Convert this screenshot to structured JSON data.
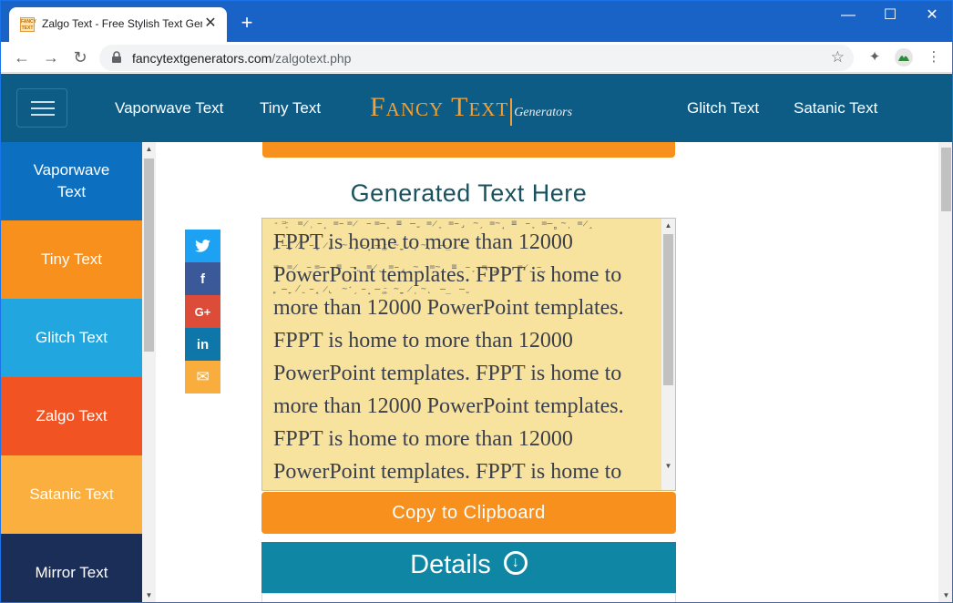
{
  "browser": {
    "tab_title": "Zalgo Text - Free Stylish Text Generator",
    "favicon_text": "FANCY TEXT",
    "url_host": "fancytextgenerators.com",
    "url_path": "/zalgotext.php",
    "new_tab": "+",
    "tab_close": "✕",
    "back": "←",
    "forward": "→",
    "reload": "↻",
    "minimize": "—",
    "maximize": "☐",
    "close": "✕",
    "star": "☆",
    "extensions": "✦",
    "menu": "⋮"
  },
  "header": {
    "nav_left": [
      "Vaporwave Text",
      "Tiny Text"
    ],
    "logo_main": "Fancy Text",
    "logo_sub": "Generators",
    "nav_right": [
      "Glitch Text",
      "Satanic Text"
    ]
  },
  "sidebar": {
    "items": [
      {
        "label": "Vaporwave Text",
        "color": "#0c6fbf"
      },
      {
        "label": "Tiny Text",
        "color": "#f8901e"
      },
      {
        "label": "Glitch Text",
        "color": "#21a6df"
      },
      {
        "label": "Zalgo Text",
        "color": "#f25322"
      },
      {
        "label": "Satanic Text",
        "color": "#fbaf3f"
      },
      {
        "label": "Mirror Text",
        "color": "#1b2e57"
      }
    ]
  },
  "main": {
    "section_title": "Generated Text Here",
    "generated_text": "FPPT is home to more than 12000 PowerPoint templates. FPPT is home to more than 12000 PowerPoint templates. FPPT is home to more than 12000 PowerPoint templates. FPPT is home to more than 12000 PowerPoint templates. FPPT is home to more than 12000 PowerPoint templates. FPPT is home to",
    "copy_button": "Copy to Clipboard",
    "details_button": "Details",
    "details_icon": "↓"
  },
  "share": [
    {
      "name": "twitter",
      "glyph": "🐦",
      "color": "#1da1f2"
    },
    {
      "name": "facebook",
      "glyph": "f",
      "color": "#3b5998"
    },
    {
      "name": "google-plus",
      "glyph": "G+",
      "color": "#dd4b39"
    },
    {
      "name": "linkedin",
      "glyph": "in",
      "color": "#0e76a8"
    },
    {
      "name": "email",
      "glyph": "✉",
      "color": "#f8ad3d"
    }
  ]
}
